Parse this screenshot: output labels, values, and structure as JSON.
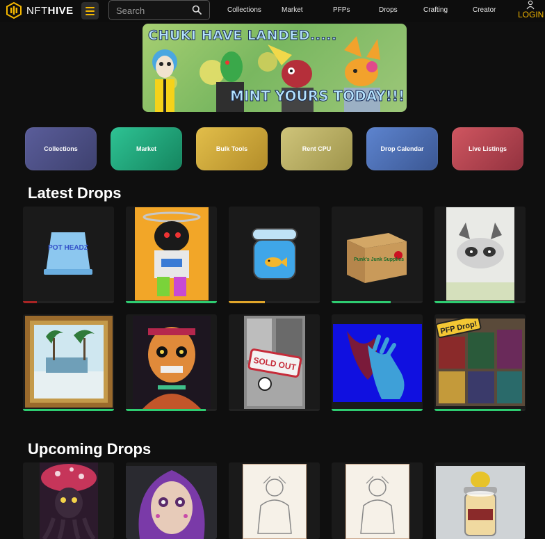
{
  "header": {
    "brand": {
      "light": "NFT",
      "bold": "HIVE"
    },
    "search": {
      "placeholder": "Search"
    },
    "nav": [
      {
        "label": "Collections"
      },
      {
        "label": "Market"
      },
      {
        "label": "PFPs"
      },
      {
        "label": "Drops"
      },
      {
        "label": "Crafting"
      },
      {
        "label": "Creator"
      }
    ],
    "login_label": "LOGIN"
  },
  "banner": {
    "headline": "CHUKI HAVE LANDED.....",
    "subline": "MINT YOURS TODAY!!!"
  },
  "quick_buttons": [
    {
      "label": "Collections",
      "color": "#4b4e86"
    },
    {
      "label": "Market",
      "color": "#1d9f78"
    },
    {
      "label": "Bulk Tools",
      "color": "#c9a53c"
    },
    {
      "label": "Rent CPU",
      "color": "#b7ad62"
    },
    {
      "label": "Drop Calendar",
      "color": "#4e6db1"
    },
    {
      "label": "Live Listings",
      "color": "#b4454f"
    }
  ],
  "latest_drops": {
    "title": "Latest Drops",
    "items": [
      {
        "art": "pot-headz-bucket-icon",
        "progress": 0.15,
        "bar_color": "#a82424",
        "label": "POT HEADZ"
      },
      {
        "art": "hooded-character-icon",
        "progress": 1.0,
        "bar_color": "#2ecc71"
      },
      {
        "art": "fish-jar-icon",
        "progress": 0.4,
        "bar_color": "#e0a52a"
      },
      {
        "art": "cardboard-box-icon",
        "progress": 0.65,
        "bar_color": "#2ecc71",
        "label": "Punk's Junk Supplies"
      },
      {
        "art": "raccoon-sketch-icon",
        "progress": 0.88,
        "bar_color": "#2ecc71"
      },
      {
        "art": "framed-beach-painting-icon",
        "progress": 1.0,
        "bar_color": "#2ecc71"
      },
      {
        "art": "zombie-portrait-icon",
        "progress": 0.88,
        "bar_color": "#2ecc71"
      },
      {
        "art": "sold-out-comic-icon",
        "progress": 0,
        "bar_color": "#2ecc71",
        "label": "SOLD OUT"
      },
      {
        "art": "hand-silhouette-icon",
        "progress": 1.0,
        "bar_color": "#2ecc71"
      },
      {
        "art": "pfp-drop-collage-icon",
        "progress": 0.95,
        "bar_color": "#2ecc71",
        "label": "PFP Drop!"
      }
    ]
  },
  "upcoming_drops": {
    "title": "Upcoming Drops",
    "items": [
      {
        "art": "mushroom-creature-icon"
      },
      {
        "art": "sugar-skull-woman-icon"
      },
      {
        "art": "pencil-sketch-warrior-icon"
      },
      {
        "art": "pencil-sketch-warrior-icon"
      },
      {
        "art": "potion-jar-icon"
      }
    ]
  }
}
